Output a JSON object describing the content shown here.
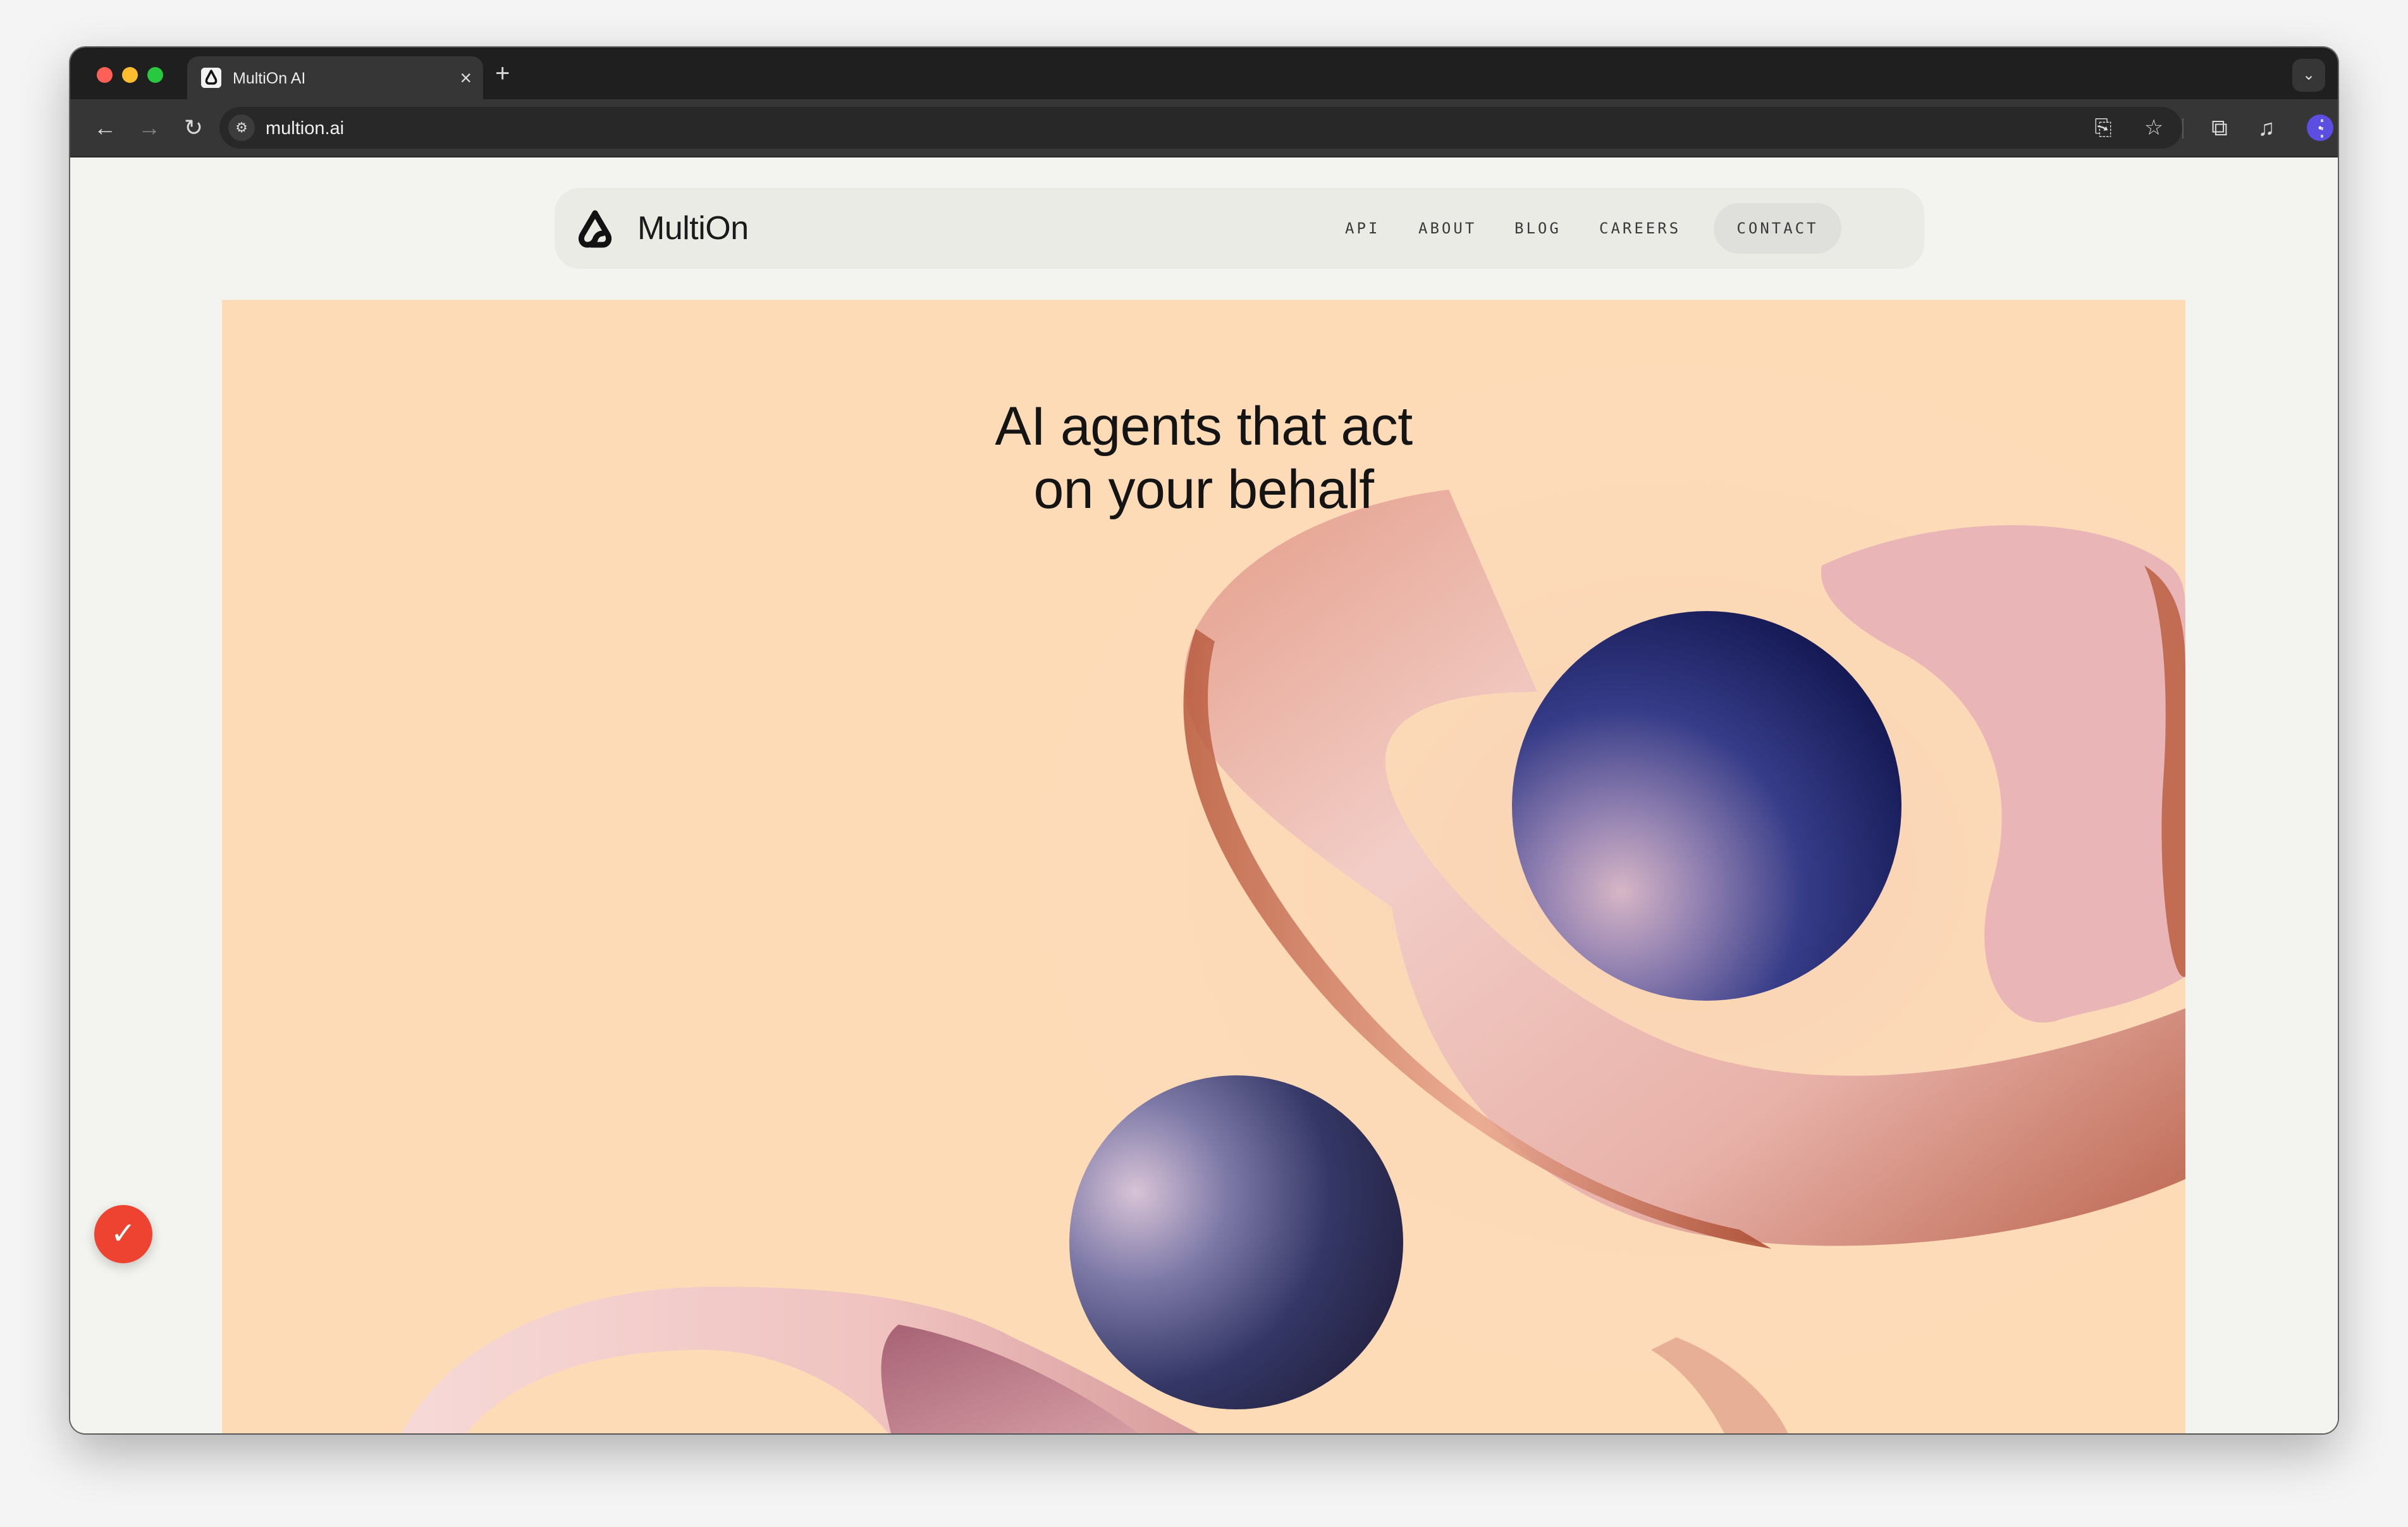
{
  "browser": {
    "tab_title": "MultiOn AI",
    "tab_close": "×",
    "new_tab": "+",
    "tab_menu_icon": "⌄",
    "url": "multion.ai",
    "back_icon": "←",
    "forward_icon": "→",
    "reload_icon": "↻",
    "site_info_icon": "⚙",
    "install_icon": "⎘",
    "bookmark_icon": "☆",
    "extensions_icon": "⧉",
    "media_icon": "♫",
    "profile_initial": "•",
    "menu_icon": "⋮"
  },
  "site": {
    "logo_text": "MultiOn",
    "nav": {
      "api": "API",
      "about": "ABOUT",
      "blog": "BLOG",
      "careers": "CAREERS",
      "contact": "CONTACT"
    },
    "hero": {
      "line1": "AI agents that act",
      "line2": "on your behalf"
    },
    "badge_icon": "✓"
  },
  "colors": {
    "hero_bg": "#fddbb8",
    "sphere": "#1b1f5e",
    "ribbon": "#e8b0a0",
    "badge": "#ee4330"
  }
}
